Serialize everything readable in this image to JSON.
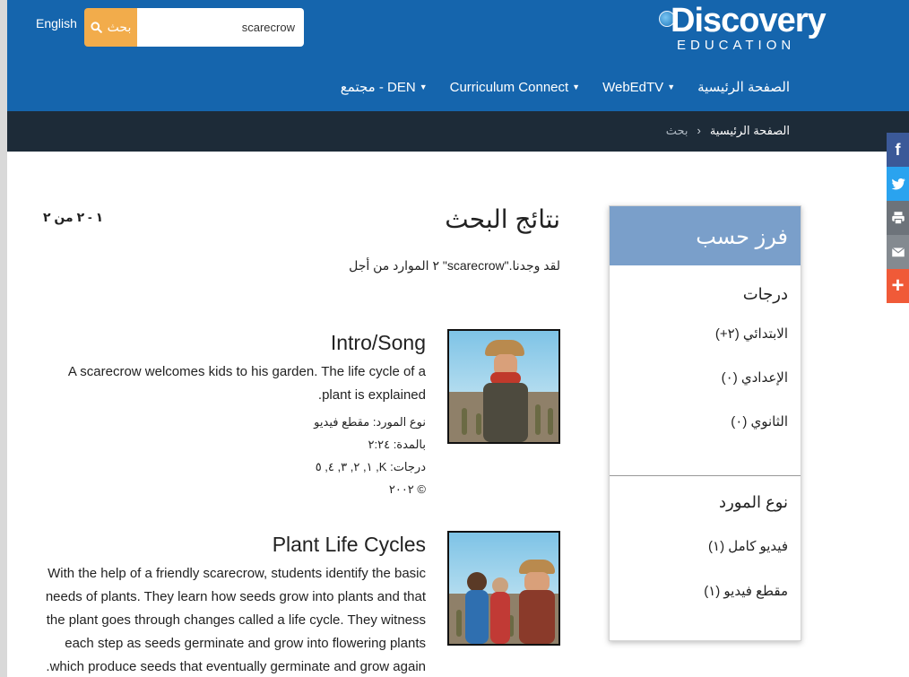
{
  "header": {
    "language_link": "English",
    "search": {
      "button_label": "بحث",
      "value": "scarecrow"
    },
    "logo": {
      "line1": "Discovery",
      "line2": "EDUCATION"
    },
    "nav": [
      {
        "label": "الصفحة الرئيسية",
        "has_dropdown": false
      },
      {
        "label": "WebEdTV",
        "has_dropdown": true
      },
      {
        "label": "Curriculum Connect",
        "has_dropdown": true
      },
      {
        "label": "مجتمع - DEN",
        "has_dropdown": true
      }
    ]
  },
  "breadcrumb": {
    "home": "الصفحة الرئيسية",
    "separator": "›",
    "current": "بحث"
  },
  "social": [
    "facebook-icon",
    "twitter-icon",
    "print-icon",
    "email-icon",
    "plus-icon"
  ],
  "colors": {
    "header_bg": "#1565ad",
    "breadcrumb_bg": "#1d2b38",
    "search_button": "#f2ac4b",
    "filter_head": "#7a9fca",
    "facebook": "#3b5998",
    "twitter": "#2aa3ef",
    "share_plus": "#f05a38"
  },
  "main": {
    "title": "نتائج البحث",
    "summary": "٢ الموارد من أجل \"scarecrow\".لقد وجدنا",
    "range": "١ - ٢ من ٢",
    "results": [
      {
        "title": "Intro/Song",
        "description": "A scarecrow welcomes kids to his garden. The life cycle of a plant is explained.",
        "meta": [
          "نوع المورد: مقطع فيديو",
          "بالمدة: ٢:٢٤",
          "درجات: K, ١, ٢, ٣, ٤, ٥",
          "© ٢٠٠٢"
        ]
      },
      {
        "title": "Plant Life Cycles",
        "description": "With the help of a friendly scarecrow, students identify the basic needs of plants. They learn how seeds grow into plants and that the plant goes through changes called a life cycle. They witness each step as seeds germinate and grow into flowering plants which produce seeds that eventually germinate and grow again.",
        "meta": []
      }
    ]
  },
  "filter": {
    "heading": "فرز حسب",
    "sections": [
      {
        "title": "درجات",
        "items": [
          "الابتدائي (٢+)",
          "الإعدادي (٠)",
          "الثانوي (٠)"
        ]
      },
      {
        "title": "نوع المورد",
        "items": [
          "فيديو كامل (١)",
          "مقطع فيديو (١)"
        ]
      }
    ]
  }
}
